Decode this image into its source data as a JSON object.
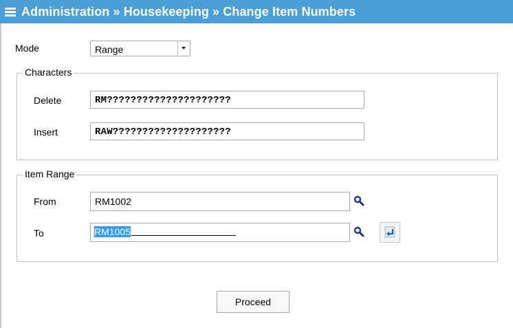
{
  "header": {
    "title": "Administration » Housekeeping » Change Item Numbers",
    "menu_icon": "hamburger-menu-icon"
  },
  "mode": {
    "label": "Mode",
    "selected": "Range"
  },
  "characters": {
    "legend": "Characters",
    "delete_label": "Delete",
    "delete_value": "RM?????????????????????",
    "insert_label": "Insert",
    "insert_value": "RAW????????????????????"
  },
  "item_range": {
    "legend": "Item Range",
    "from_label": "From",
    "from_value": "RM1002",
    "to_label": "To",
    "to_value": "RM1005"
  },
  "icons": {
    "lookup": "magnifier-icon",
    "refresh": "refresh-icon"
  },
  "buttons": {
    "proceed": "Proceed"
  },
  "colors": {
    "header_bg": "#4a9fd8",
    "selection": "#3399ff"
  }
}
